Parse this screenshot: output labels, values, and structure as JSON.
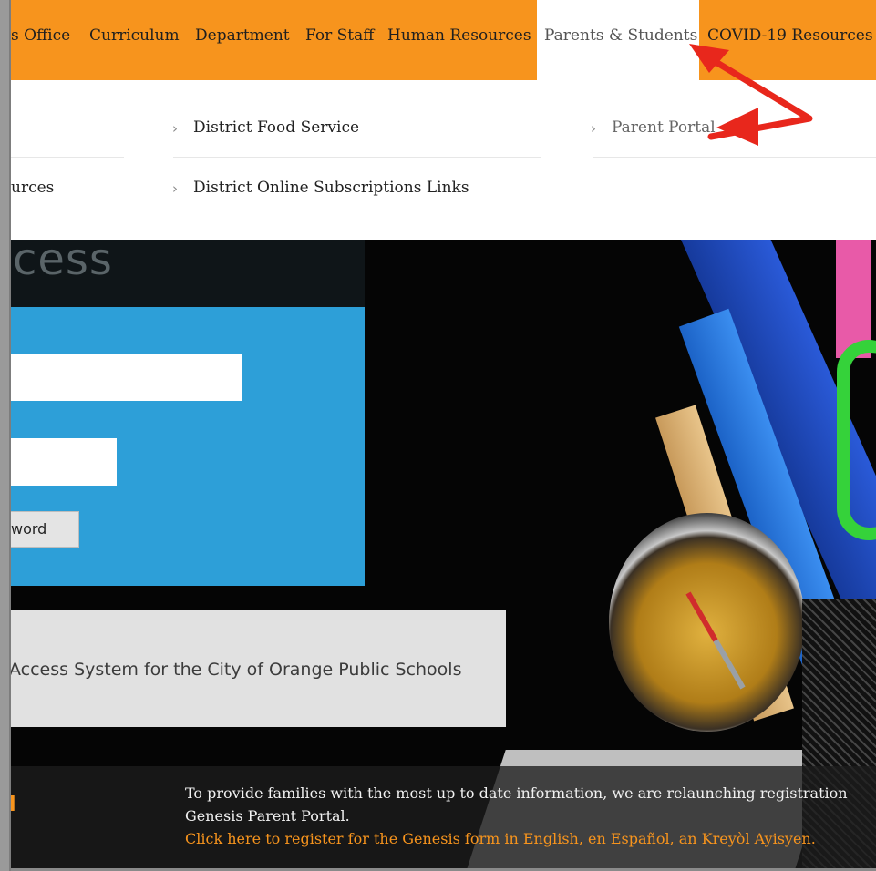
{
  "nav": {
    "items": [
      {
        "label": "s Office"
      },
      {
        "label": "Curriculum"
      },
      {
        "label": "Department"
      },
      {
        "label": "For Staff"
      },
      {
        "label": "Human Resources"
      },
      {
        "label": "Parents & Students"
      },
      {
        "label": "COVID-19 Resources"
      }
    ]
  },
  "dropdown": {
    "col1": [
      "urces"
    ],
    "col2": [
      "District Food Service",
      "District Online Subscriptions  Links"
    ],
    "col3": [
      "Parent Portal"
    ]
  },
  "hero": {
    "heading": "cess",
    "password_button": "word",
    "system_text": "Access System for the City of Orange Public Schools",
    "caption_left": "l",
    "caption_line1": "To provide families with the most up to date information, we are relaunching registration",
    "caption_line2": "Genesis Parent Portal.",
    "caption_link": "Click here to register for the Genesis form in English, en Español, an Kreyòl Ayisyen."
  },
  "colors": {
    "nav_bg": "#f7941d",
    "panel_blue": "#2d9fd8",
    "annotation_red": "#e8271c"
  }
}
